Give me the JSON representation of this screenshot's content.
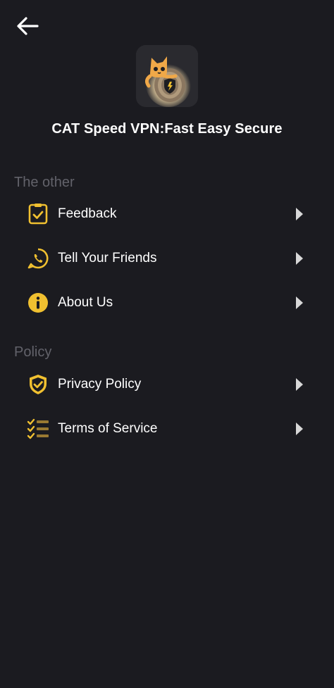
{
  "header": {
    "back_icon": "arrow-left-icon",
    "app_name": "CAT Speed VPN:Fast Easy Secure",
    "logo_icon": "cat-vpn-logo"
  },
  "sections": [
    {
      "title": "The other",
      "items": [
        {
          "label": "Feedback",
          "icon": "feedback-icon"
        },
        {
          "label": "Tell Your Friends",
          "icon": "share-phone-icon"
        },
        {
          "label": "About Us",
          "icon": "info-icon"
        }
      ]
    },
    {
      "title": "Policy",
      "items": [
        {
          "label": "Privacy Policy",
          "icon": "shield-check-icon"
        },
        {
          "label": "Terms of Service",
          "icon": "checklist-icon"
        }
      ]
    }
  ],
  "colors": {
    "background": "#1b1b20",
    "accent": "#f0c030",
    "section_header": "#62626a",
    "chevron": "#d8d8d8"
  }
}
